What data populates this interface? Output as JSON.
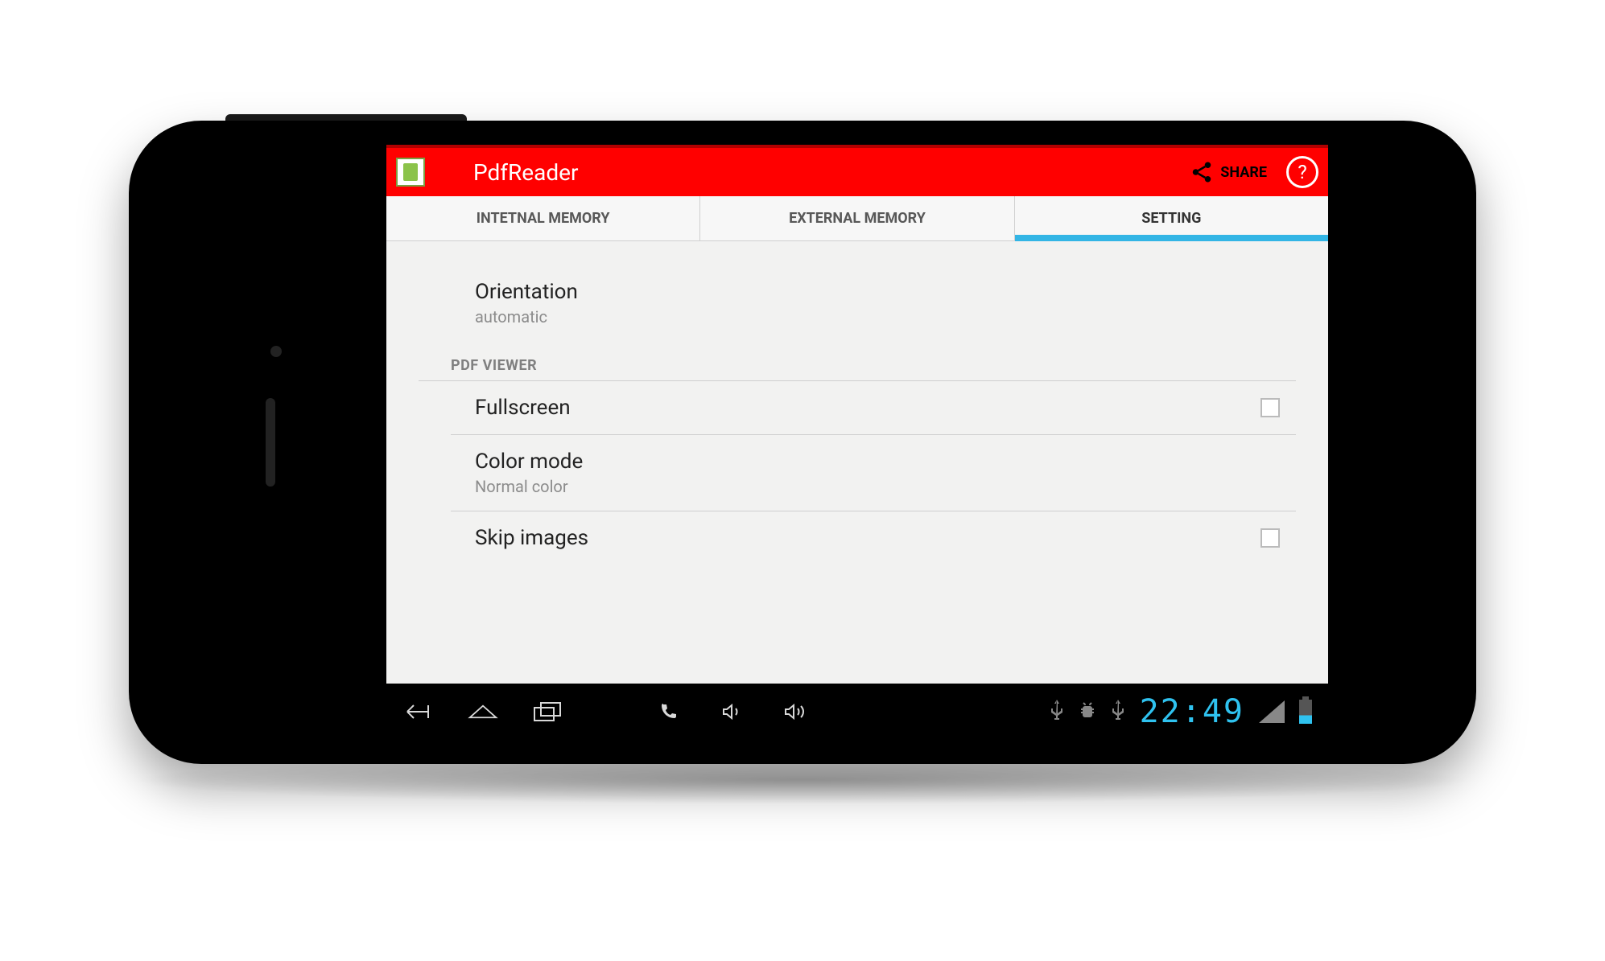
{
  "actionbar": {
    "title": "PdfReader",
    "share_label": "SHARE",
    "help_label": "?"
  },
  "tabs": {
    "internal": "INTETNAL MEMORY",
    "external": "EXTERNAL MEMORY",
    "setting": "SETTING"
  },
  "settings": {
    "orientation_title": "Orientation",
    "orientation_value": "automatic",
    "section_pdf_viewer": "PDF VIEWER",
    "fullscreen_title": "Fullscreen",
    "colormode_title": "Color mode",
    "colormode_value": "Normal color",
    "skipimages_title": "Skip images"
  },
  "navbar": {
    "clock": "22:49"
  }
}
